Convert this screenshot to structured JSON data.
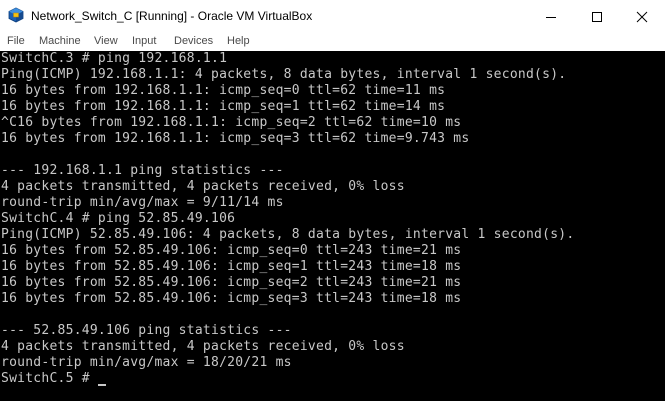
{
  "window": {
    "title": "Network_Switch_C [Running] - Oracle VM VirtualBox",
    "icon": "virtualbox-icon"
  },
  "menu": {
    "items": [
      {
        "label": "File"
      },
      {
        "label": "Machine"
      },
      {
        "label": "View"
      },
      {
        "label": "Input"
      },
      {
        "label": "Devices"
      },
      {
        "label": "Help"
      }
    ]
  },
  "terminal": {
    "lines": [
      "SwitchC.3 # ping 192.168.1.1",
      "Ping(ICMP) 192.168.1.1: 4 packets, 8 data bytes, interval 1 second(s).",
      "16 bytes from 192.168.1.1: icmp_seq=0 ttl=62 time=11 ms",
      "16 bytes from 192.168.1.1: icmp_seq=1 ttl=62 time=14 ms",
      "^C16 bytes from 192.168.1.1: icmp_seq=2 ttl=62 time=10 ms",
      "16 bytes from 192.168.1.1: icmp_seq=3 ttl=62 time=9.743 ms",
      "",
      "--- 192.168.1.1 ping statistics ---",
      "4 packets transmitted, 4 packets received, 0% loss",
      "round-trip min/avg/max = 9/11/14 ms",
      "SwitchC.4 # ping 52.85.49.106",
      "Ping(ICMP) 52.85.49.106: 4 packets, 8 data bytes, interval 1 second(s).",
      "16 bytes from 52.85.49.106: icmp_seq=0 ttl=243 time=21 ms",
      "16 bytes from 52.85.49.106: icmp_seq=1 ttl=243 time=18 ms",
      "16 bytes from 52.85.49.106: icmp_seq=2 ttl=243 time=21 ms",
      "16 bytes from 52.85.49.106: icmp_seq=3 ttl=243 time=18 ms",
      "",
      "--- 52.85.49.106 ping statistics ---",
      "4 packets transmitted, 4 packets received, 0% loss",
      "round-trip min/avg/max = 18/20/21 ms",
      "SwitchC.5 # "
    ]
  },
  "colors": {
    "terminal_bg": "#000000",
    "terminal_fg": "#c8c8c8",
    "titlebar_bg": "#ffffff"
  }
}
